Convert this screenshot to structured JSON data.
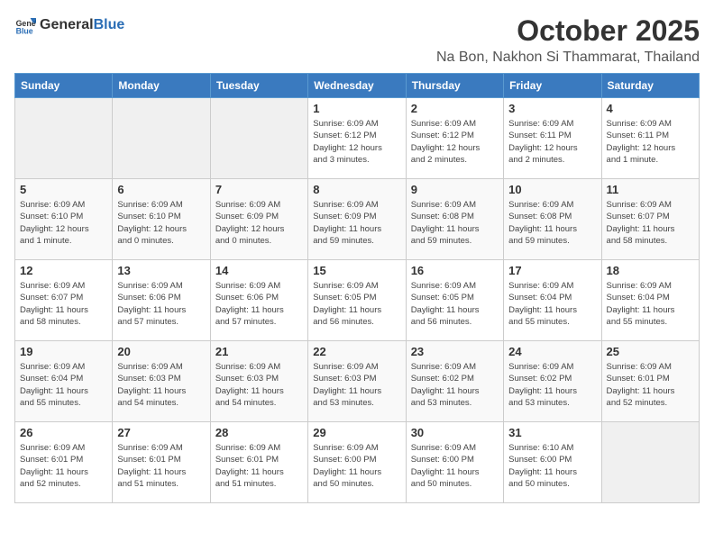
{
  "header": {
    "logo_general": "General",
    "logo_blue": "Blue",
    "title": "October 2025",
    "subtitle": "Na Bon, Nakhon Si Thammarat, Thailand"
  },
  "days_of_week": [
    "Sunday",
    "Monday",
    "Tuesday",
    "Wednesday",
    "Thursday",
    "Friday",
    "Saturday"
  ],
  "weeks": [
    [
      {
        "day": "",
        "info": ""
      },
      {
        "day": "",
        "info": ""
      },
      {
        "day": "",
        "info": ""
      },
      {
        "day": "1",
        "info": "Sunrise: 6:09 AM\nSunset: 6:12 PM\nDaylight: 12 hours\nand 3 minutes."
      },
      {
        "day": "2",
        "info": "Sunrise: 6:09 AM\nSunset: 6:12 PM\nDaylight: 12 hours\nand 2 minutes."
      },
      {
        "day": "3",
        "info": "Sunrise: 6:09 AM\nSunset: 6:11 PM\nDaylight: 12 hours\nand 2 minutes."
      },
      {
        "day": "4",
        "info": "Sunrise: 6:09 AM\nSunset: 6:11 PM\nDaylight: 12 hours\nand 1 minute."
      }
    ],
    [
      {
        "day": "5",
        "info": "Sunrise: 6:09 AM\nSunset: 6:10 PM\nDaylight: 12 hours\nand 1 minute."
      },
      {
        "day": "6",
        "info": "Sunrise: 6:09 AM\nSunset: 6:10 PM\nDaylight: 12 hours\nand 0 minutes."
      },
      {
        "day": "7",
        "info": "Sunrise: 6:09 AM\nSunset: 6:09 PM\nDaylight: 12 hours\nand 0 minutes."
      },
      {
        "day": "8",
        "info": "Sunrise: 6:09 AM\nSunset: 6:09 PM\nDaylight: 11 hours\nand 59 minutes."
      },
      {
        "day": "9",
        "info": "Sunrise: 6:09 AM\nSunset: 6:08 PM\nDaylight: 11 hours\nand 59 minutes."
      },
      {
        "day": "10",
        "info": "Sunrise: 6:09 AM\nSunset: 6:08 PM\nDaylight: 11 hours\nand 59 minutes."
      },
      {
        "day": "11",
        "info": "Sunrise: 6:09 AM\nSunset: 6:07 PM\nDaylight: 11 hours\nand 58 minutes."
      }
    ],
    [
      {
        "day": "12",
        "info": "Sunrise: 6:09 AM\nSunset: 6:07 PM\nDaylight: 11 hours\nand 58 minutes."
      },
      {
        "day": "13",
        "info": "Sunrise: 6:09 AM\nSunset: 6:06 PM\nDaylight: 11 hours\nand 57 minutes."
      },
      {
        "day": "14",
        "info": "Sunrise: 6:09 AM\nSunset: 6:06 PM\nDaylight: 11 hours\nand 57 minutes."
      },
      {
        "day": "15",
        "info": "Sunrise: 6:09 AM\nSunset: 6:05 PM\nDaylight: 11 hours\nand 56 minutes."
      },
      {
        "day": "16",
        "info": "Sunrise: 6:09 AM\nSunset: 6:05 PM\nDaylight: 11 hours\nand 56 minutes."
      },
      {
        "day": "17",
        "info": "Sunrise: 6:09 AM\nSunset: 6:04 PM\nDaylight: 11 hours\nand 55 minutes."
      },
      {
        "day": "18",
        "info": "Sunrise: 6:09 AM\nSunset: 6:04 PM\nDaylight: 11 hours\nand 55 minutes."
      }
    ],
    [
      {
        "day": "19",
        "info": "Sunrise: 6:09 AM\nSunset: 6:04 PM\nDaylight: 11 hours\nand 55 minutes."
      },
      {
        "day": "20",
        "info": "Sunrise: 6:09 AM\nSunset: 6:03 PM\nDaylight: 11 hours\nand 54 minutes."
      },
      {
        "day": "21",
        "info": "Sunrise: 6:09 AM\nSunset: 6:03 PM\nDaylight: 11 hours\nand 54 minutes."
      },
      {
        "day": "22",
        "info": "Sunrise: 6:09 AM\nSunset: 6:03 PM\nDaylight: 11 hours\nand 53 minutes."
      },
      {
        "day": "23",
        "info": "Sunrise: 6:09 AM\nSunset: 6:02 PM\nDaylight: 11 hours\nand 53 minutes."
      },
      {
        "day": "24",
        "info": "Sunrise: 6:09 AM\nSunset: 6:02 PM\nDaylight: 11 hours\nand 53 minutes."
      },
      {
        "day": "25",
        "info": "Sunrise: 6:09 AM\nSunset: 6:01 PM\nDaylight: 11 hours\nand 52 minutes."
      }
    ],
    [
      {
        "day": "26",
        "info": "Sunrise: 6:09 AM\nSunset: 6:01 PM\nDaylight: 11 hours\nand 52 minutes."
      },
      {
        "day": "27",
        "info": "Sunrise: 6:09 AM\nSunset: 6:01 PM\nDaylight: 11 hours\nand 51 minutes."
      },
      {
        "day": "28",
        "info": "Sunrise: 6:09 AM\nSunset: 6:01 PM\nDaylight: 11 hours\nand 51 minutes."
      },
      {
        "day": "29",
        "info": "Sunrise: 6:09 AM\nSunset: 6:00 PM\nDaylight: 11 hours\nand 50 minutes."
      },
      {
        "day": "30",
        "info": "Sunrise: 6:09 AM\nSunset: 6:00 PM\nDaylight: 11 hours\nand 50 minutes."
      },
      {
        "day": "31",
        "info": "Sunrise: 6:10 AM\nSunset: 6:00 PM\nDaylight: 11 hours\nand 50 minutes."
      },
      {
        "day": "",
        "info": ""
      }
    ]
  ]
}
